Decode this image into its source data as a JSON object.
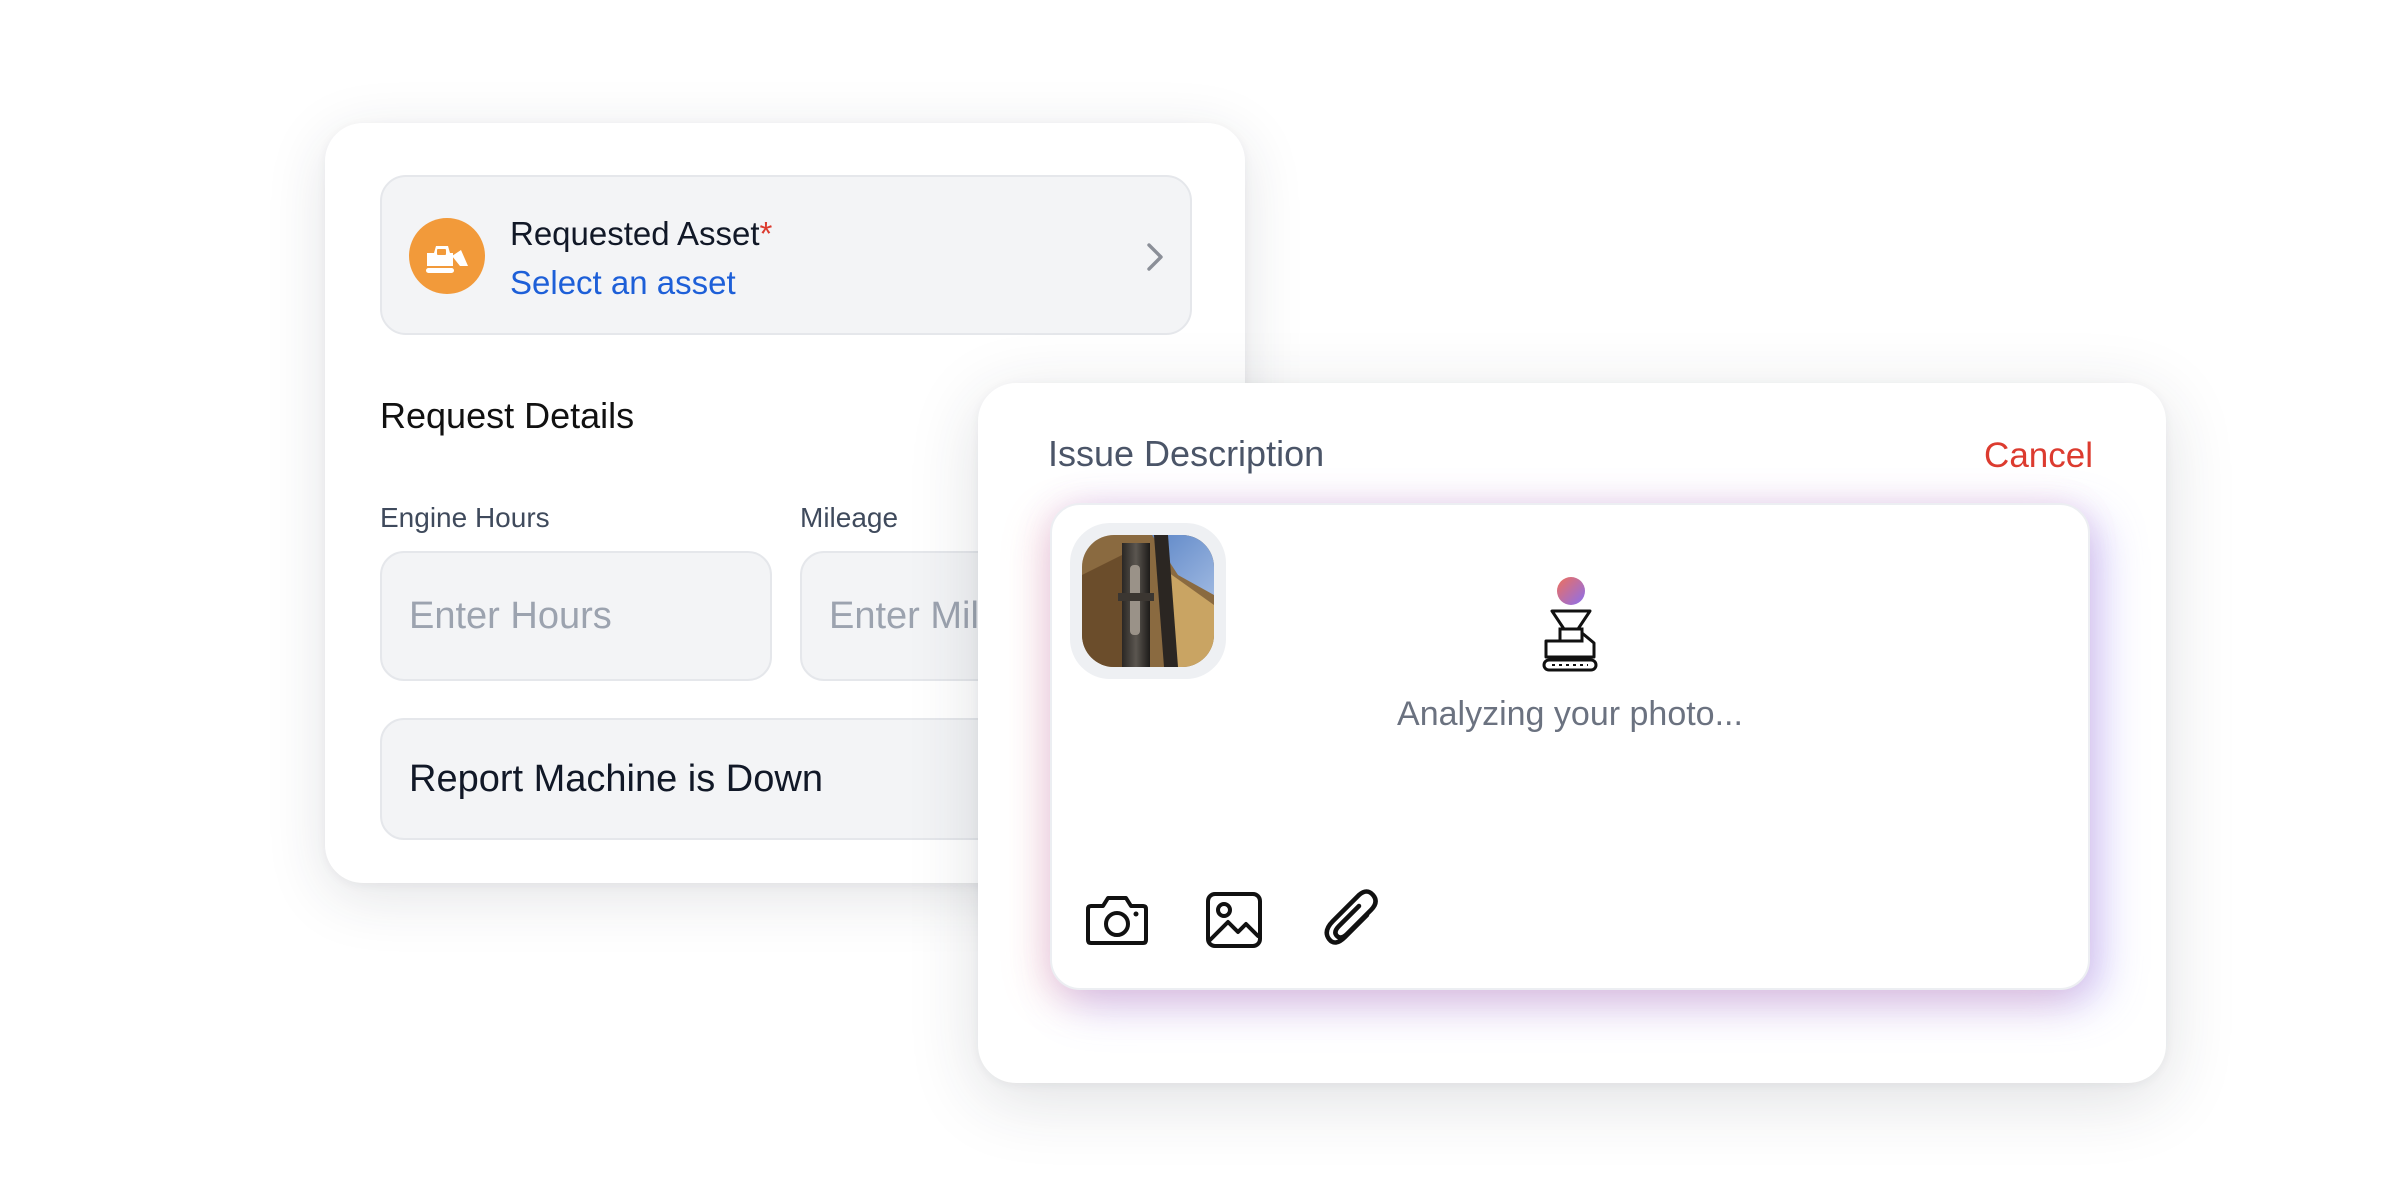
{
  "request_form": {
    "asset": {
      "icon": "excavator-icon",
      "title": "Requested Asset",
      "required_mark": "*",
      "action_label": "Select an asset"
    },
    "details_heading": "Request Details",
    "engine_hours": {
      "label": "Engine Hours",
      "placeholder": "Enter Hours"
    },
    "mileage": {
      "label": "Mileage",
      "placeholder": "Enter Mil"
    },
    "report_button": "Report Machine is Down"
  },
  "issue_panel": {
    "heading": "Issue Description",
    "cancel_label": "Cancel",
    "status_text": "Analyzing your photo...",
    "status_icon": "ai-machine-analyzing-icon",
    "attachments": [
      "camera-icon",
      "image-icon",
      "paperclip-icon"
    ]
  },
  "colors": {
    "accent_orange": "#f29a3a",
    "link_blue": "#1d5fd8",
    "danger_red": "#dc3b2f"
  }
}
